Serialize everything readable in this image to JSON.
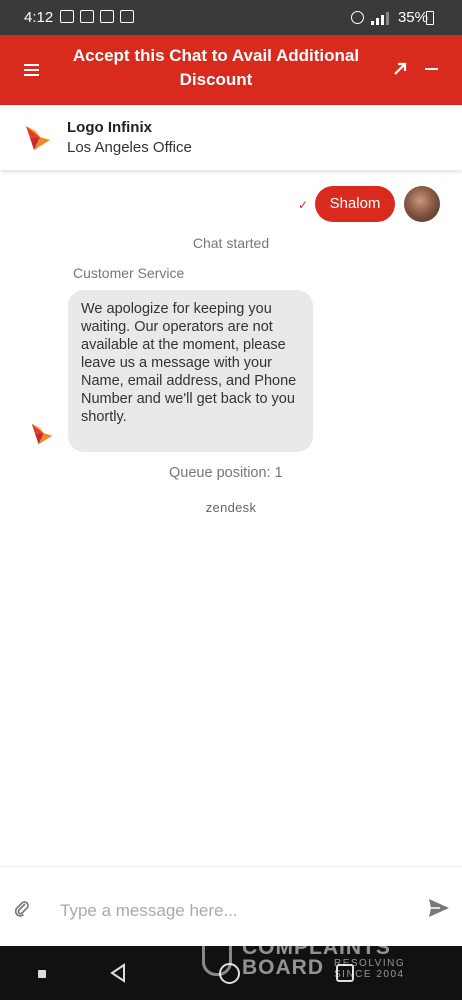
{
  "status_bar": {
    "time": "4:12",
    "battery_percent": "35%",
    "left_icons": [
      "gallery-icon",
      "mail-icon",
      "mail-icon",
      "battery-saver-icon"
    ],
    "right_icons": [
      "alarm-icon",
      "vibrate-icon",
      "signal-icon",
      "battery-icon"
    ]
  },
  "top_bar": {
    "title": "Accept this Chat to Avail Additional Discount",
    "background_color": "#d82b1e",
    "icons": [
      "menu-icon",
      "expand-icon",
      "minimize-icon"
    ]
  },
  "agent": {
    "name": "Logo Infinix",
    "office": "Los Angeles Office"
  },
  "conversation": {
    "sent_message": "Shalom",
    "system_notice": "Chat started",
    "sender_name": "Customer Service",
    "received_message": "We apologize for keeping you waiting. Our operators are not available at the moment, please leave us a message with your Name, email address, and Phone Number and we'll get back to you shortly.",
    "queue_position": "Queue position: 1",
    "provider": "zendesk"
  },
  "composer": {
    "placeholder": "Type a message here..."
  },
  "watermark": {
    "line1": "COMPLAINTS",
    "line2": "BOARD",
    "sub1": "RESOLVING",
    "sub2": "SINCE 2004"
  }
}
